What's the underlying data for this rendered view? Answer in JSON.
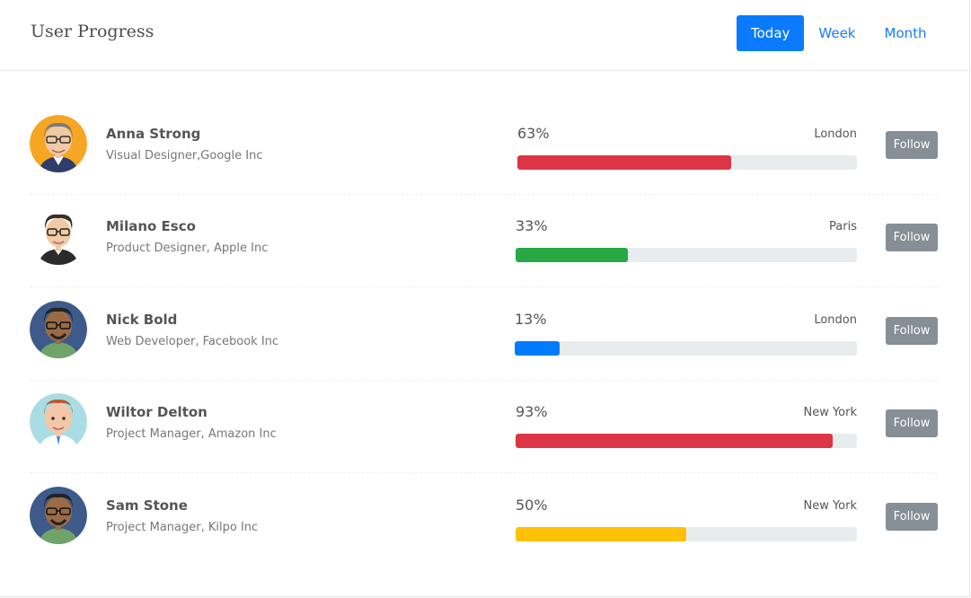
{
  "header": {
    "title": "User Progress",
    "tabs": [
      {
        "label": "Today",
        "active": true
      },
      {
        "label": "Week",
        "active": false
      },
      {
        "label": "Month",
        "active": false
      }
    ]
  },
  "users": [
    {
      "name": "Anna Strong",
      "role": "Visual Designer,Google Inc",
      "percent_label": "63%",
      "progress": 63,
      "city": "London",
      "follow_label": "Follow",
      "bar_color": "#dc3545"
    },
    {
      "name": "Milano Esco",
      "role": "Product Designer, Apple Inc",
      "percent_label": "33%",
      "progress": 33,
      "city": "Paris",
      "follow_label": "Follow",
      "bar_color": "#28a745"
    },
    {
      "name": "Nick Bold",
      "role": "Web Developer, Facebook Inc",
      "percent_label": "13%",
      "progress": 13,
      "city": "London",
      "follow_label": "Follow",
      "bar_color": "#007bff"
    },
    {
      "name": "Wiltor Delton",
      "role": "Project Manager, Amazon Inc",
      "percent_label": "93%",
      "progress": 93,
      "city": "New York",
      "follow_label": "Follow",
      "bar_color": "#dc3545"
    },
    {
      "name": "Sam Stone",
      "role": "Project Manager, Kilpo Inc",
      "percent_label": "50%",
      "progress": 50,
      "city": "New York",
      "follow_label": "Follow",
      "bar_color": "#ffc107"
    }
  ]
}
